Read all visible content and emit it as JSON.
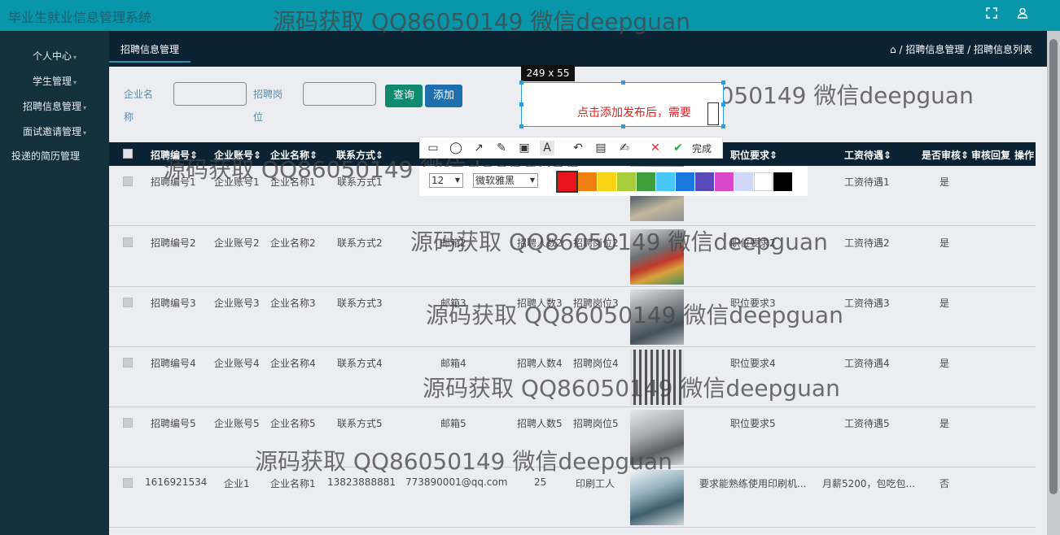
{
  "app": {
    "title": "毕业生就业信息管理系统"
  },
  "topbar": {
    "fullscreen_icon": "expand-icon",
    "user_icon": "user-icon"
  },
  "sidebar": {
    "items": [
      {
        "label": "个人中心"
      },
      {
        "label": "学生管理"
      },
      {
        "label": "招聘信息管理"
      },
      {
        "label": "面试邀请管理"
      },
      {
        "label": "投递的简历管理"
      }
    ]
  },
  "header": {
    "tab": "招聘信息管理",
    "breadcrumb": "/ 招聘信息管理 / 招聘信息列表"
  },
  "search": {
    "company_label_1": "企业名",
    "company_label_2": "称",
    "position_label_1": "招聘岗",
    "position_label_2": "位",
    "query_label": "查询",
    "add_label": "添加"
  },
  "table": {
    "columns": [
      "招聘编号",
      "企业账号",
      "企业名称",
      "联系方式",
      "职位要求",
      "工资待遇",
      "是否审核",
      "审核回复",
      "操作"
    ],
    "rows": [
      {
        "no": "招聘编号1",
        "account": "企业账号1",
        "name": "企业名称1",
        "contact": "联系方式1",
        "email": "",
        "count": "",
        "position": "",
        "req": "",
        "salary": "工资待遇1",
        "audit": "是"
      },
      {
        "no": "招聘编号2",
        "account": "企业账号2",
        "name": "企业名称2",
        "contact": "联系方式2",
        "email": "邮箱2",
        "count": "招聘人数2",
        "position": "招聘岗位2",
        "req": "职位要求2",
        "salary": "工资待遇2",
        "audit": "是"
      },
      {
        "no": "招聘编号3",
        "account": "企业账号3",
        "name": "企业名称3",
        "contact": "联系方式3",
        "email": "邮箱3",
        "count": "招聘人数3",
        "position": "招聘岗位3",
        "req": "职位要求3",
        "salary": "工资待遇3",
        "audit": "是"
      },
      {
        "no": "招聘编号4",
        "account": "企业账号4",
        "name": "企业名称4",
        "contact": "联系方式4",
        "email": "邮箱4",
        "count": "招聘人数4",
        "position": "招聘岗位4",
        "req": "职位要求4",
        "salary": "工资待遇4",
        "audit": "是"
      },
      {
        "no": "招聘编号5",
        "account": "企业账号5",
        "name": "企业名称5",
        "contact": "联系方式5",
        "email": "邮箱5",
        "count": "招聘人数5",
        "position": "招聘岗位5",
        "req": "职位要求5",
        "salary": "工资待遇5",
        "audit": "是"
      },
      {
        "no": "1616921534",
        "account": "企业1",
        "name": "企业名称1",
        "contact": "13823888881",
        "email": "773890001@qq.com",
        "count": "25",
        "position": "印刷工人",
        "req": "要求能熟练使用印刷机...",
        "salary": "月薪5200，包吃包...",
        "audit": "否"
      }
    ]
  },
  "snip": {
    "size": "249 x 55",
    "text": "点击添加发布后，需要",
    "font_size": "12",
    "font_family": "微软雅黑",
    "done_label": "完成",
    "colors": [
      "#e8141c",
      "#f08010",
      "#f8d416",
      "#a8cc3c",
      "#3ea03c",
      "#48c8f8",
      "#1c78e0",
      "#5848b8",
      "#d848c8",
      "#d0d8f8",
      "#ffffff",
      "#000000"
    ]
  },
  "watermark": "源码获取 QQ86050149 微信deepguan"
}
